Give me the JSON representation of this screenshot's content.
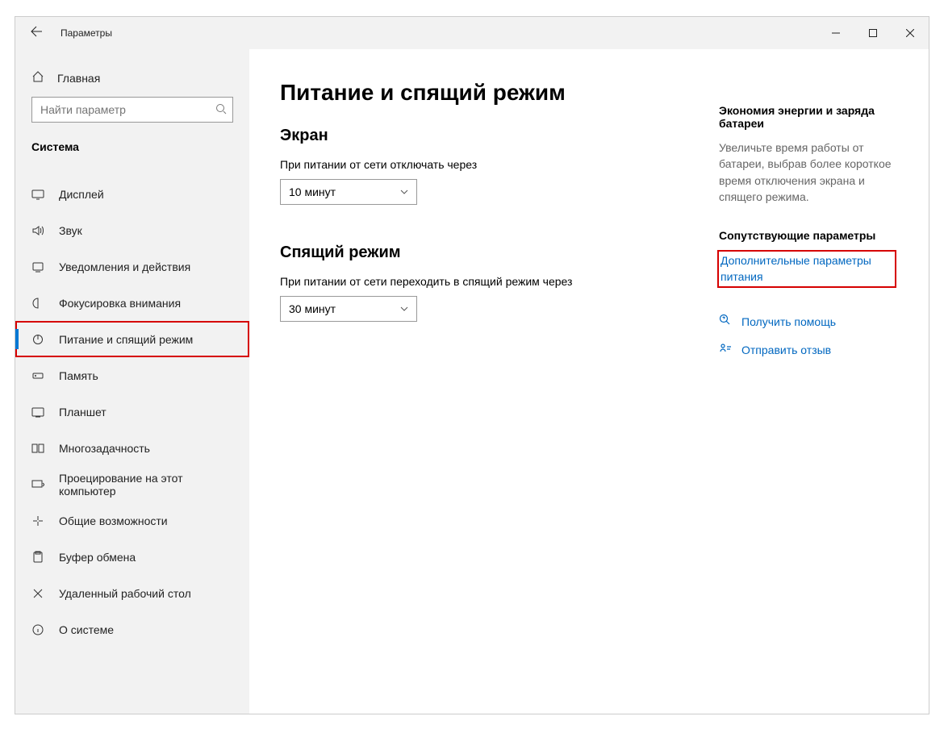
{
  "window": {
    "title": "Параметры"
  },
  "sidebar": {
    "home": "Главная",
    "search_placeholder": "Найти параметр",
    "section": "Система",
    "items": [
      {
        "label": "Дисплей"
      },
      {
        "label": "Звук"
      },
      {
        "label": "Уведомления и действия"
      },
      {
        "label": "Фокусировка внимания"
      },
      {
        "label": "Питание и спящий режим"
      },
      {
        "label": "Память"
      },
      {
        "label": "Планшет"
      },
      {
        "label": "Многозадачность"
      },
      {
        "label": "Проецирование на этот компьютер"
      },
      {
        "label": "Общие возможности"
      },
      {
        "label": "Буфер обмена"
      },
      {
        "label": "Удаленный рабочий стол"
      },
      {
        "label": "О системе"
      }
    ]
  },
  "main": {
    "title": "Питание и спящий режим",
    "screen": {
      "heading": "Экран",
      "label": "При питании от сети отключать через",
      "value": "10 минут"
    },
    "sleep": {
      "heading": "Спящий режим",
      "label": "При питании от сети переходить в спящий режим через",
      "value": "30 минут"
    }
  },
  "right": {
    "energy_heading": "Экономия энергии и заряда батареи",
    "energy_text": "Увеличьте время работы от батареи, выбрав более короткое время отключения экрана и спящего режима.",
    "related_heading": "Сопутствующие параметры",
    "related_link": "Дополнительные параметры питания",
    "help": "Получить помощь",
    "feedback": "Отправить отзыв"
  }
}
